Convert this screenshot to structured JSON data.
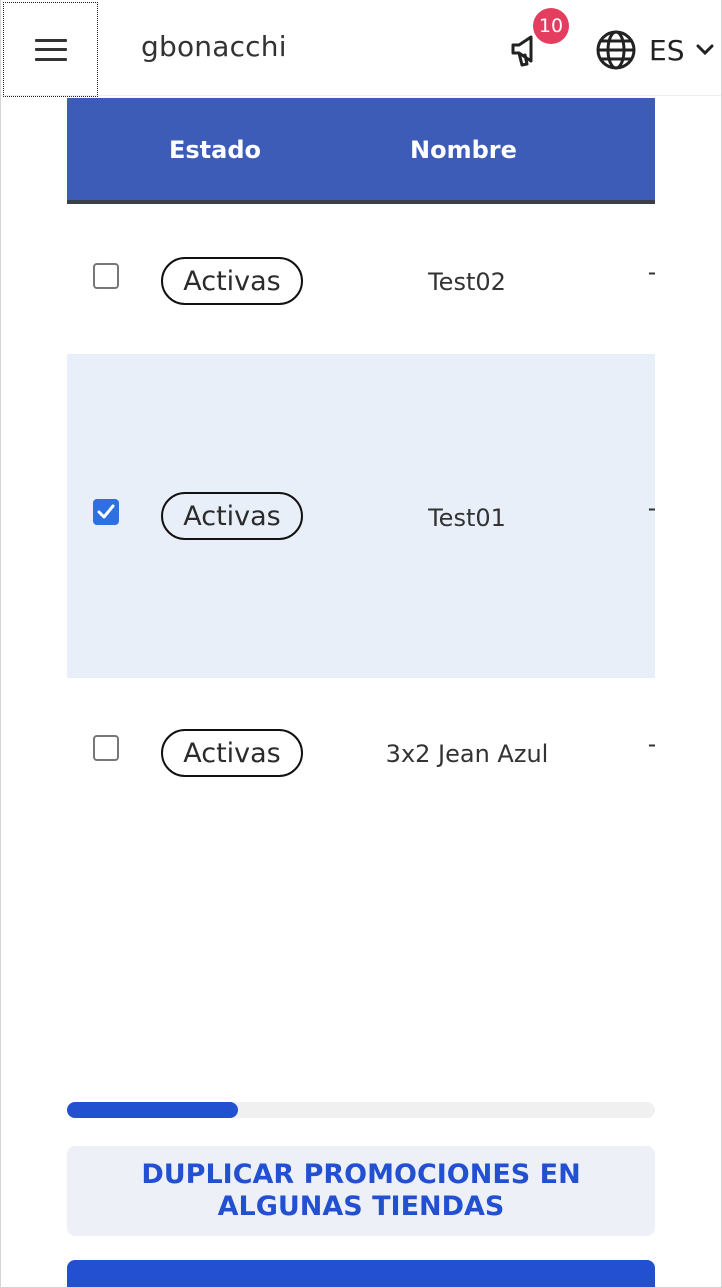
{
  "header": {
    "username": "gbonacchi",
    "notification_count": "10",
    "language": "ES"
  },
  "table": {
    "columns": [
      "Estado",
      "Nombre"
    ],
    "rows": [
      {
        "checked": false,
        "status": "Activas",
        "name": "Test02",
        "next_col": "T"
      },
      {
        "checked": true,
        "status": "Activas",
        "name": "Test01",
        "next_col": "T"
      },
      {
        "checked": false,
        "status": "Activas",
        "name": "3x2 Jean Azul",
        "next_col": "T"
      }
    ]
  },
  "scrollbar": {
    "position_fraction": 0.0,
    "visible_fraction": 0.29
  },
  "actions": {
    "duplicate_label": "DUPLICAR PROMOCIONES EN ALGUNAS TIENDAS"
  },
  "colors": {
    "header_bg": "#3d5cb8",
    "accent": "#2350d1",
    "badge": "#e43d60",
    "selected_row": "#e9eff8"
  }
}
